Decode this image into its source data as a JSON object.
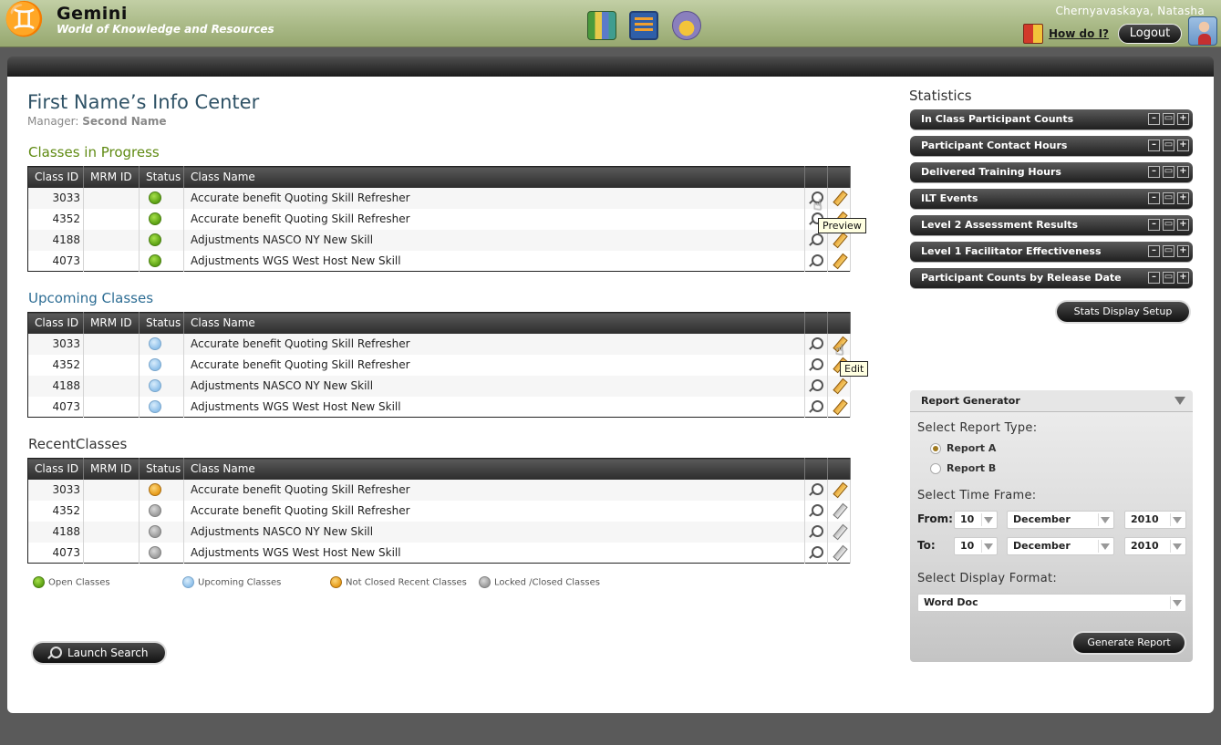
{
  "header": {
    "logo_glyph": "♊",
    "app_name": "Gemini",
    "tagline": "World of Knowledge and Resources",
    "icons": [
      "books-icon",
      "abacus-icon",
      "shield-icon"
    ],
    "user_name": "Chernyavaskaya, Natasha",
    "how_do_i": "How do I?",
    "logout": "Logout"
  },
  "page": {
    "title": "First Name’s Info Center",
    "manager_label": "Manager:",
    "manager_name": "Second Name"
  },
  "columns": [
    "Class ID",
    "MRM ID",
    "Status",
    "Class Name"
  ],
  "sections": [
    {
      "title": "Classes in Progress",
      "rows": [
        {
          "id": "3033",
          "mrm": "",
          "status": "green",
          "name": "Accurate benefit Quoting Skill Refresher"
        },
        {
          "id": "4352",
          "mrm": "",
          "status": "green",
          "name": "Accurate benefit Quoting Skill Refresher"
        },
        {
          "id": "4188",
          "mrm": "",
          "status": "green",
          "name": "Adjustments NASCO NY New Skill"
        },
        {
          "id": "4073",
          "mrm": "",
          "status": "green",
          "name": "Adjustments WGS West Host New Skill"
        }
      ]
    },
    {
      "title": "Upcoming Classes",
      "rows": [
        {
          "id": "3033",
          "mrm": "",
          "status": "blue",
          "name": "Accurate benefit Quoting Skill Refresher"
        },
        {
          "id": "4352",
          "mrm": "",
          "status": "blue",
          "name": "Accurate benefit Quoting Skill Refresher"
        },
        {
          "id": "4188",
          "mrm": "",
          "status": "blue",
          "name": "Adjustments NASCO NY New Skill"
        },
        {
          "id": "4073",
          "mrm": "",
          "status": "blue",
          "name": "Adjustments WGS West Host New Skill"
        }
      ]
    },
    {
      "title": "RecentClasses",
      "rows": [
        {
          "id": "3033",
          "mrm": "",
          "status": "orange",
          "name": "Accurate benefit Quoting Skill Refresher"
        },
        {
          "id": "4352",
          "mrm": "",
          "status": "gray",
          "name": "Accurate benefit Quoting Skill Refresher"
        },
        {
          "id": "4188",
          "mrm": "",
          "status": "gray",
          "name": "Adjustments NASCO NY New Skill"
        },
        {
          "id": "4073",
          "mrm": "",
          "status": "gray",
          "name": "Adjustments WGS West Host New Skill"
        }
      ]
    }
  ],
  "tooltips": {
    "preview": "Preview",
    "edit": "Edit"
  },
  "legend": [
    {
      "color": "green",
      "label": "Open Classes"
    },
    {
      "color": "blue",
      "label": "Upcoming Classes"
    },
    {
      "color": "orange",
      "label": "Not Closed Recent Classes"
    },
    {
      "color": "gray",
      "label": "Locked /Closed Classes"
    }
  ],
  "launch_search": "Launch Search",
  "statistics": {
    "title": "Statistics",
    "items": [
      "In Class Participant Counts",
      "Participant Contact Hours",
      "Delivered Training Hours",
      "ILT Events",
      "Level 2 Assessment Results",
      "Level 1 Facilitator Effectiveness",
      "Participant Counts by Release Date"
    ],
    "controls": [
      "–",
      "▭",
      "+"
    ],
    "setup_button": "Stats Display Setup"
  },
  "report_generator": {
    "title": "Report Generator",
    "type_label": "Select Report Type:",
    "report_types": [
      {
        "label": "Report A",
        "selected": true
      },
      {
        "label": "Report B",
        "selected": false
      }
    ],
    "time_frame_label": "Select Time Frame:",
    "from_label": "From:",
    "to_label": "To:",
    "from": {
      "day": "10",
      "month": "December",
      "year": "2010"
    },
    "to": {
      "day": "10",
      "month": "December",
      "year": "2010"
    },
    "format_label": "Select Display Format:",
    "format_value": "Word Doc",
    "generate_button": "Generate Report"
  },
  "colors": {
    "status_green": "#5aa012",
    "status_blue": "#8ec0ea",
    "status_orange": "#e69a17",
    "status_gray": "#9a9a9a",
    "header_bg": "#a9b986"
  }
}
